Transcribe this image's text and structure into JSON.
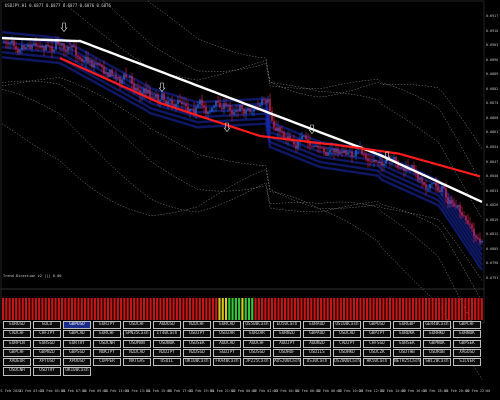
{
  "window": {
    "title": "USDJPY.H1 0.6877 0.6877 0.6877 0.6876 0.6876"
  },
  "indicator": {
    "label": "Trend Direction v2 ||| 0.00",
    "fill_pattern": "rrrrrrrrrrrrrrrrrrrrrrrrrrrrrrrrrrrrrrrrrrrrrrrrrrrrrrrrrrrrrrrrrryyyggggygggrrrrrrrrrrrrrrrrrrrrrrrrrrrrrrrrrrrrrrrrrrrrrrrrrrrrrrrrrrrrrrrrrrrrrr",
    "colors": {
      "r": "#c81616",
      "y": "#d8c81a",
      "g": "#34c83a"
    }
  },
  "colors": {
    "background": "#000000",
    "bull_candle": "#2a6be0",
    "bear_candle": "#e0254b",
    "white_ma": "#ffffff",
    "red_ma": "#ff1c1c",
    "band_dotted": "#8a8a8a",
    "blue_fan": "#1a2bb8",
    "arrow": "#e6e6e6",
    "button_active": "#1a2a8a"
  },
  "price_axis": [
    "0.6917",
    "0.6910",
    "0.6903",
    "0.6896",
    "0.6889",
    "0.6882",
    "0.6875",
    "0.6868",
    "0.6861",
    "0.6854",
    "0.6847",
    "0.6840",
    "0.6833",
    "0.6826",
    "0.6819",
    "0.6812",
    "0.6805",
    "0.6798",
    "0.6791"
  ],
  "time_axis": [
    "21 Feb 2024",
    "21 Feb 03:00",
    "21 Feb 05:00",
    "21 Feb 07:00",
    "21 Feb 09:00",
    "21 Feb 11:00",
    "21 Feb 13:00",
    "21 Feb 15:00",
    "21 Feb 17:00",
    "21 Feb 19:00",
    "21 Feb 21:00",
    "22 Feb 00:00",
    "22 Feb 02:00",
    "22 Feb 04:00",
    "22 Feb 06:00",
    "22 Feb 08:00",
    "22 Feb 10:00",
    "22 Feb 12:00",
    "22 Feb 14:00",
    "22 Feb 16:00",
    "22 Feb 18:00",
    "22 Feb 20:00",
    "22 Feb 22:00"
  ],
  "symbols": [
    "EURUSD",
    "GOLD",
    "GBPUSD",
    "EURJPY",
    "USDCHF",
    "AUDUSD",
    "NZDCHF",
    "EURCAD",
    "US500Cash",
    "EU50Cash",
    "EURAUD",
    "US100Cash",
    "GBPUSD",
    "EURGBP",
    "GER40Cash",
    "GBPCHF",
    "CADCHF",
    "CHFJPY",
    "GBPCAD",
    "EURCHF",
    "SPN35Cash",
    "IT40Cash",
    "USDJPY",
    "USDZAR",
    "EURZAR",
    "EURNZD",
    "GBPAUD",
    "USDCAD",
    "GBPJPY",
    "EURDKK",
    "EURHKD",
    "EURNOK",
    "EURPLN",
    "EURSGD",
    "EURTRY",
    "USDCNH",
    "USDMXN",
    "USDNOK",
    "USDSEK",
    "AUDCAD",
    "AUDCHF",
    "AUDJPY",
    "AUDNZD",
    "CADJPY",
    "CHFSGD",
    "EURSEK",
    "GBPNOK",
    "GBPSEK",
    "GBPCHF",
    "GBPNZD",
    "GBPSGD",
    "NOKJPY",
    "NZDCAD",
    "NZDJPY",
    "NZDSGD",
    "SGDJPY",
    "USDSGD",
    "USDHUF",
    "USDILS",
    "USDHKD",
    "USDCZK",
    "USDTHB",
    "USDRUB",
    "XAGUSD",
    "XAUEUR",
    "XPTUSD",
    "XPDUSD",
    "COPPER",
    "NATGAS",
    "USOIL",
    "UK100Cash",
    "FRA40Cash",
    "JP225Cash",
    "AUS200Cash",
    "US30Cash",
    "US2000Cash",
    "HK50Cash",
    "NETH25Cash",
    "SWI20Cash",
    "SILVER",
    "USDCNH",
    "USDTRY",
    "UK100Cash"
  ],
  "active_symbol_index": 2
}
